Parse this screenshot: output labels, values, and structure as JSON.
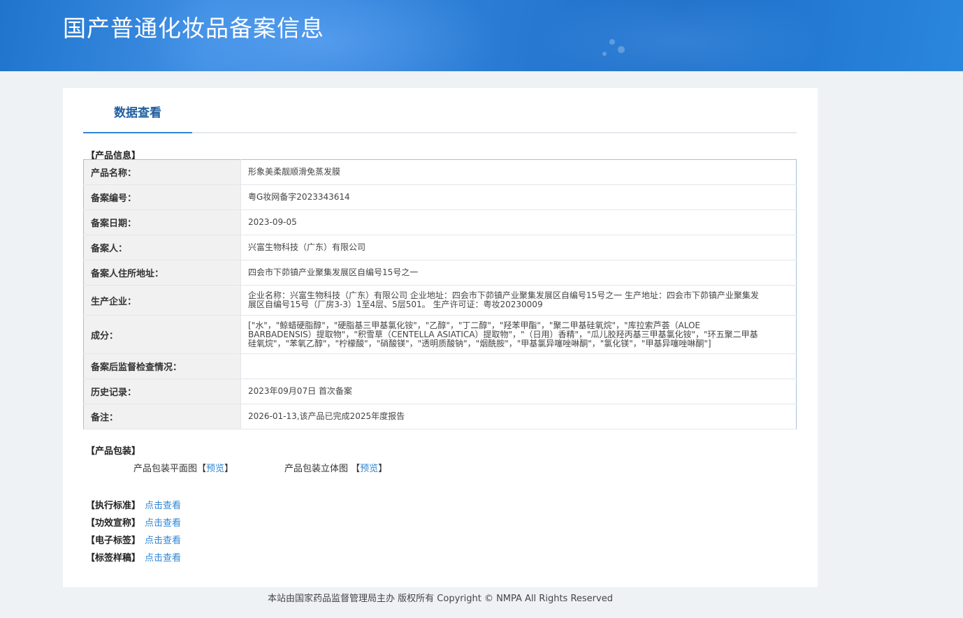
{
  "banner": {
    "title": "国产普通化妆品备案信息"
  },
  "tab": {
    "label": "数据查看"
  },
  "product_info": {
    "section_label": "【产品信息】",
    "rows": [
      {
        "key": "产品名称：",
        "value": "形象美柔靓顺滑免蒸发膜"
      },
      {
        "key": "备案编号：",
        "value": "粤G妆网备字2023343614"
      },
      {
        "key": "备案日期：",
        "value": "2023-09-05"
      },
      {
        "key": "备案人：",
        "value": "兴富生物科技（广东）有限公司"
      },
      {
        "key": "备案人住所地址：",
        "value": "四会市下茆镇产业聚集发展区自编号15号之一"
      },
      {
        "key": "生产企业：",
        "value": "企业名称：兴富生物科技（广东）有限公司 企业地址：四会市下茆镇产业聚集发展区自编号15号之一 生产地址：四会市下茆镇产业聚集发展区自编号15号（厂房3-3）1至4层、5层501。 生产许可证：粤妆20230009"
      },
      {
        "key": "成分：",
        "value": "[\"水\"，\"鲸蜡硬脂醇\"，\"硬脂基三甲基氯化铵\"，\"乙醇\"，\"丁二醇\"，\"羟苯甲酯\"，\"聚二甲基硅氧烷\"，\"库拉索芦荟（ALOE BARBADENSIS）提取物\"，\"积雪草（CENTELLA ASIATICA）提取物\"，\"（日用）香精\"，\"瓜儿胶羟丙基三甲基氯化铵\"，\"环五聚二甲基硅氧烷\"，\"苯氧乙醇\"，\"柠檬酸\"，\"硝酸镁\"，\"透明质酸钠\"，\"烟酰胺\"，\"甲基氯异噻唑啉酮\"，\"氯化镁\"，\"甲基异噻唑啉酮\"]"
      },
      {
        "key": "备案后监督检查情况：",
        "value": ""
      },
      {
        "key": "历史记录：",
        "value": "2023年09月07日 首次备案"
      },
      {
        "key": "备注：",
        "value": "2026-01-13,该产品已完成2025年度报告"
      }
    ]
  },
  "packaging": {
    "section_label": "【产品包装】",
    "flat_label": "产品包装平面图",
    "solid_label": "产品包装立体图",
    "preview_link": "预览",
    "bracket_open": "【",
    "bracket_close": "】"
  },
  "documents": [
    {
      "label": "【执行标准】",
      "link": "点击查看"
    },
    {
      "label": "【功效宣称】",
      "link": "点击查看"
    },
    {
      "label": "【电子标签】",
      "link": "点击查看"
    },
    {
      "label": "【标签样稿】",
      "link": "点击查看"
    }
  ],
  "footer": {
    "text": "本站由国家药品监督管理局主办 版权所有 Copyright © NMPA All Rights Reserved"
  },
  "colors": {
    "banner": "#2d7fd7",
    "tab_text": "#1f5f9e",
    "accent": "#2f86d6",
    "table_border": "#a9bfdc",
    "key_bg": "#f1f1f1"
  }
}
